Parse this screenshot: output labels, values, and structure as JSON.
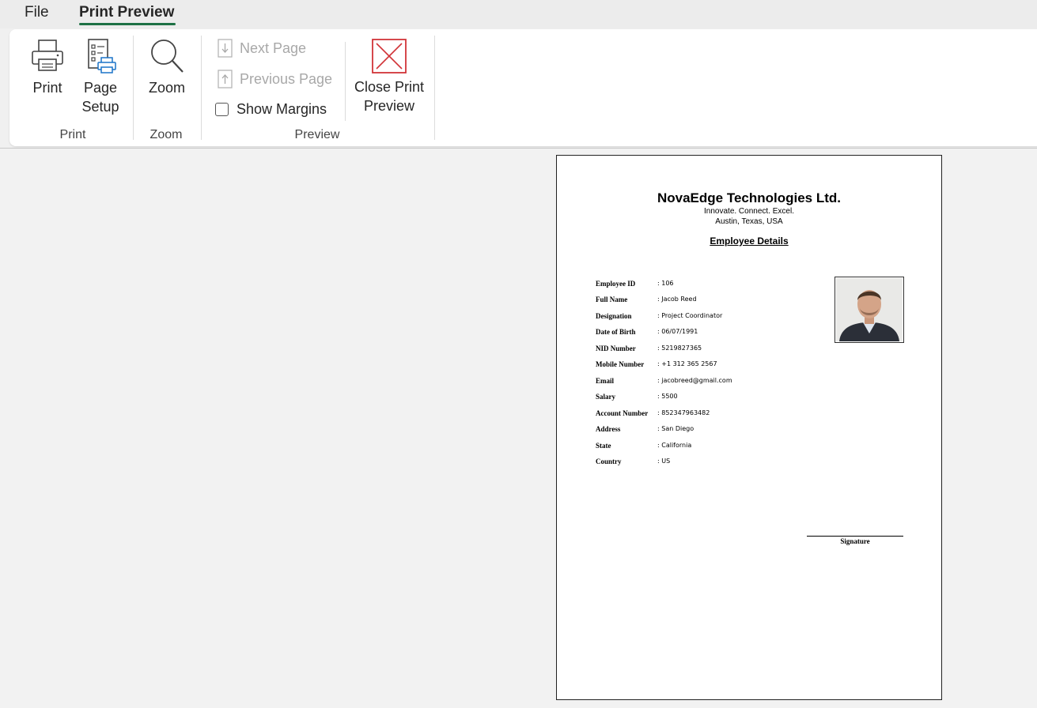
{
  "menu": {
    "tabs": [
      {
        "label": "File"
      },
      {
        "label": "Print Preview"
      }
    ]
  },
  "ribbon": {
    "print_group": {
      "label": "Print",
      "print_button": "Print",
      "page_setup_line1": "Page",
      "page_setup_line2": "Setup"
    },
    "zoom_group": {
      "label": "Zoom",
      "zoom_button": "Zoom"
    },
    "preview_group": {
      "label": "Preview",
      "next_page": "Next Page",
      "previous_page": "Previous Page",
      "show_margins": "Show Margins",
      "show_margins_checked": false,
      "close_line1": "Close Print",
      "close_line2": "Preview"
    }
  },
  "document": {
    "company": "NovaEdge Technologies Ltd.",
    "tagline": "Innovate. Connect. Excel.",
    "location": "Austin, Texas, USA",
    "title": "Employee Details",
    "fields": [
      {
        "label": "Employee ID",
        "value": ": 106"
      },
      {
        "label": "Full Name",
        "value": ": Jacob Reed"
      },
      {
        "label": "Designation",
        "value": ": Project Coordinator"
      },
      {
        "label": "Date of Birth",
        "value": ": 06/07/1991"
      },
      {
        "label": "NID Number",
        "value": ": 5219827365"
      },
      {
        "label": "Mobile Number",
        "value": ": +1 312 365 2567"
      },
      {
        "label": "Email",
        "value": ": jacobreed@gmail.com"
      },
      {
        "label": "Salary",
        "value": ": 5500"
      },
      {
        "label": "Account Number",
        "value": ": 852347963482"
      },
      {
        "label": "Address",
        "value": ": San Diego"
      },
      {
        "label": "State",
        "value": ": California"
      },
      {
        "label": "Country",
        "value": ": US"
      }
    ],
    "signature_label": "Signature"
  },
  "colors": {
    "accent_green": "#1e7145",
    "close_red": "#d13438",
    "disabled_text": "#a8a8a8"
  },
  "icons": [
    "printer-icon",
    "page-setup-icon",
    "magnifier-icon",
    "down-arrow-icon",
    "up-arrow-icon",
    "checkbox-icon",
    "close-x-icon"
  ]
}
